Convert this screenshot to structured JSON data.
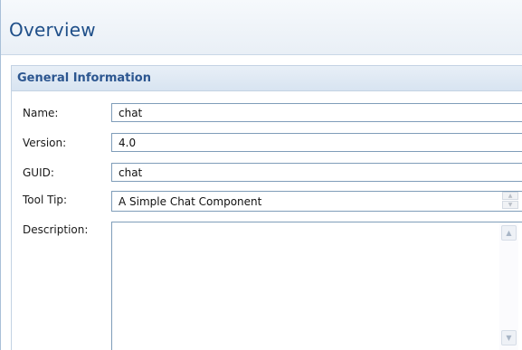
{
  "header": {
    "title": "Overview"
  },
  "section": {
    "title": "General Information"
  },
  "fields": {
    "name": {
      "label": "Name:",
      "value": "chat"
    },
    "version": {
      "label": "Version:",
      "value": "4.0"
    },
    "guid": {
      "label": "GUID:",
      "value": "chat"
    },
    "tooltip": {
      "label": "Tool Tip:",
      "value": "A Simple Chat Component"
    },
    "description": {
      "label": "Description:",
      "value": ""
    }
  },
  "icons": {
    "spinner_up": "▲",
    "spinner_down": "▼",
    "scroll_up": "▲",
    "scroll_down": "▼"
  },
  "colors": {
    "title": "#1f4f89",
    "section_title": "#2c5690",
    "input_border": "#7f9db9"
  }
}
